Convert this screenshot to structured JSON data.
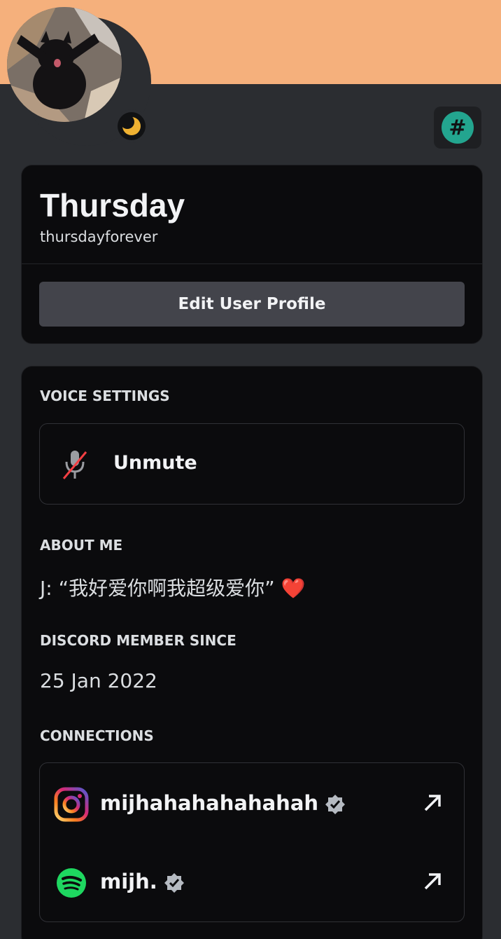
{
  "colors": {
    "banner": "#f5b07c",
    "background": "#2b2d31",
    "card": "#0b0b0d",
    "button": "#43444b",
    "badge": "#23a58f",
    "spotify": "#1ed760",
    "mute_slash": "#f23f43",
    "idle_moon": "#f0b232"
  },
  "profile": {
    "avatar_icon": "avatar-cat-photo",
    "status_icon": "moon-idle-icon",
    "badge_icon": "hashtag-badge-icon",
    "display_name": "Thursday",
    "username": "thursdayforever",
    "edit_button_label": "Edit User Profile"
  },
  "voice": {
    "section_label": "VOICE SETTINGS",
    "unmute_label": "Unmute",
    "icon": "microphone-muted-icon"
  },
  "about": {
    "section_label": "ABOUT ME",
    "text": "J: “我好爱你啊我超级爱你”",
    "emoji": "❤️"
  },
  "member_since": {
    "section_label": "DISCORD MEMBER SINCE",
    "date": "25 Jan 2022"
  },
  "connections": {
    "section_label": "CONNECTIONS",
    "items": [
      {
        "service": "instagram",
        "icon": "instagram-icon",
        "name": "mijhahahahahahah",
        "verified": true
      },
      {
        "service": "spotify",
        "icon": "spotify-icon",
        "name": "mijh.",
        "verified": true
      }
    ]
  }
}
